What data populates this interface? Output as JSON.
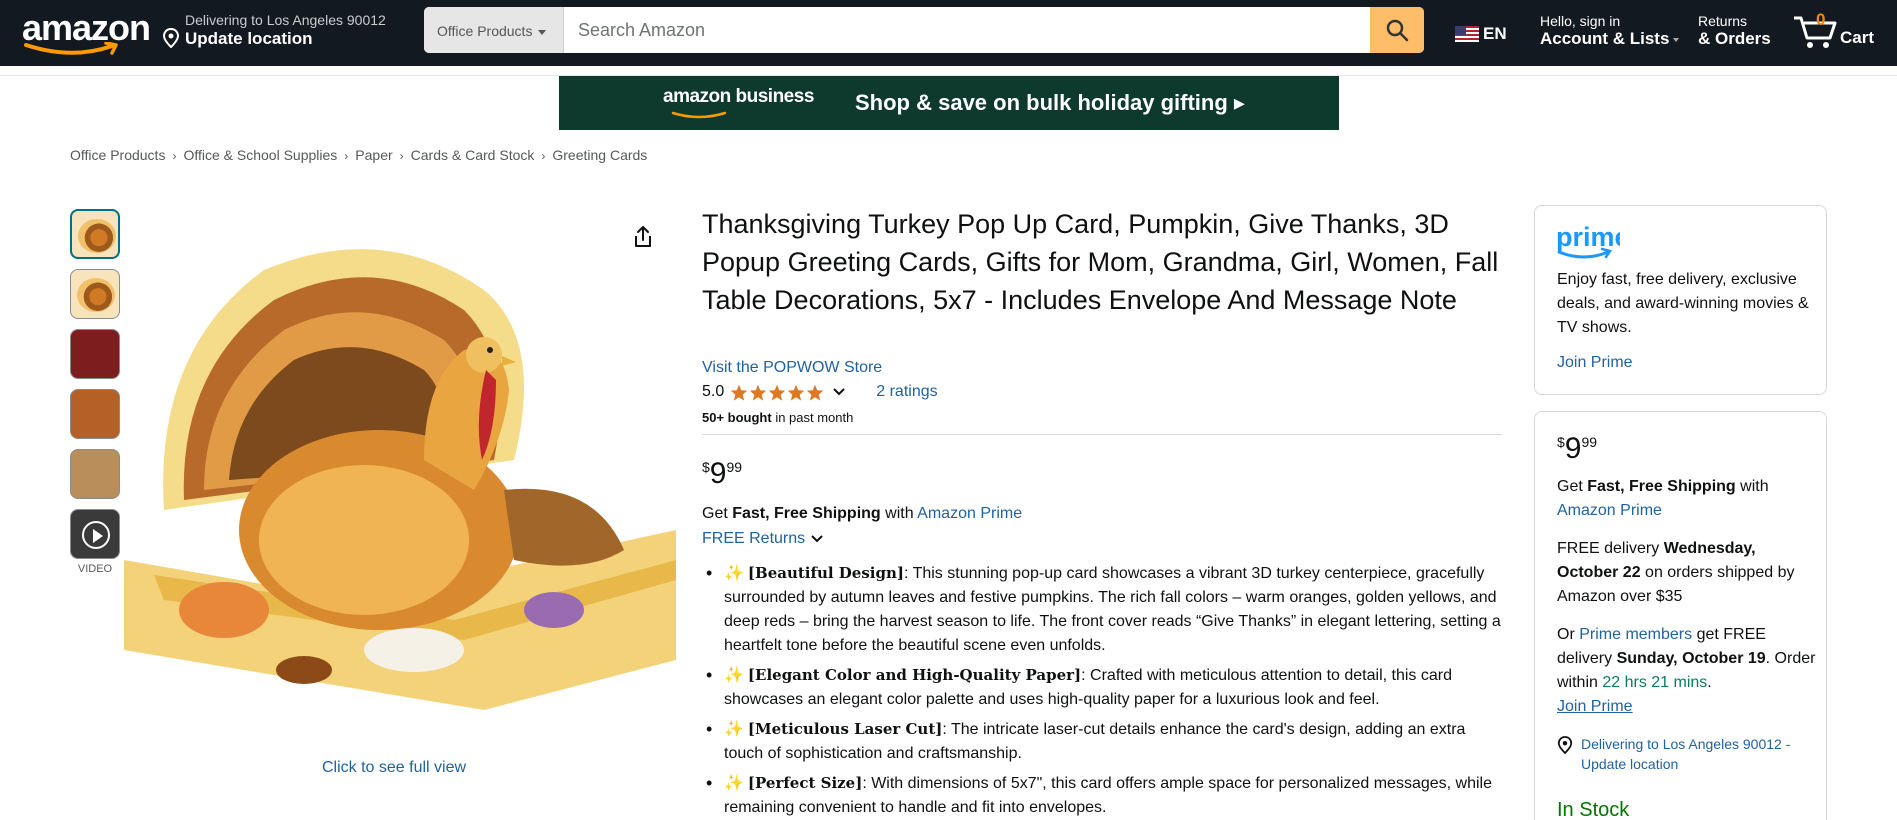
{
  "nav": {
    "logo": "amazon",
    "deliver_line1": "Delivering to Los Angeles 90012",
    "deliver_line2": "Update location",
    "search_category": "Office Products",
    "search_placeholder": "Search Amazon",
    "language": "EN",
    "account_line1": "Hello, sign in",
    "account_line2": "Account & Lists",
    "orders_line1": "Returns",
    "orders_line2": "& Orders",
    "cart_count": "0",
    "cart_label": "Cart"
  },
  "banner": {
    "brand": "amazon business",
    "promo": "Shop & save on bulk holiday gifting ▸"
  },
  "breadcrumb": [
    "Office Products",
    "Office & School Supplies",
    "Paper",
    "Cards & Card Stock",
    "Greeting Cards"
  ],
  "gallery": {
    "video_label": "VIDEO",
    "full_view": "Click to see full view"
  },
  "product": {
    "title": "Thanksgiving Turkey Pop Up Card, Pumpkin, Give Thanks, 3D Popup Greeting Cards, Gifts for Mom, Grandma, Girl, Women, Fall Table Decorations, 5x7 - Includes Envelope And Message Note",
    "store": "Visit the POPWOW Store",
    "rating_value": "5.0",
    "rating_count": "2 ratings",
    "bought_bold": "50+ bought",
    "bought_rest": " in past month",
    "price_symbol": "$",
    "price_whole": "9",
    "price_cents": "99",
    "ship_pre": "Get ",
    "ship_bold": "Fast, Free Shipping",
    "ship_mid": " with ",
    "ship_link": "Amazon Prime",
    "free_returns": "FREE Returns",
    "bullets": [
      {
        "head": "[Beautiful Design]",
        "text": ": This stunning pop-up card showcases a vibrant 3D turkey centerpiece, gracefully surrounded by autumn leaves and festive pumpkins. The rich fall colors – warm oranges, golden yellows, and deep reds – bring the harvest season to life. The front cover reads “Give Thanks” in elegant lettering, setting a heartfelt tone before the beautiful scene even unfolds."
      },
      {
        "head": "[Elegant Color and High-Quality Paper]",
        "text": ": Crafted with meticulous attention to detail, this card showcases an elegant color palette and uses high-quality paper for a luxurious look and feel."
      },
      {
        "head": "[Meticulous Laser Cut]",
        "text": ": The intricate laser-cut details enhance the card's design, adding an extra touch of sophistication and craftsmanship."
      },
      {
        "head": "[Perfect Size]",
        "text": ": With dimensions of 5x7\", this card offers ample space for personalized messages, while remaining convenient to handle and fit into envelopes."
      }
    ]
  },
  "prime_box": {
    "logo": "prime",
    "description": "Enjoy fast, free delivery, exclusive deals, and award-winning movies & TV shows.",
    "join": "Join Prime"
  },
  "buy_box": {
    "price_symbol": "$",
    "price_whole": "9",
    "price_cents": "99",
    "ship_pre": "Get ",
    "ship_bold": "Fast, Free Shipping",
    "ship_mid": " with",
    "ship_link": "Amazon Prime",
    "delivery_pre": "FREE delivery ",
    "delivery_date": "Wednesday, October 22",
    "delivery_post": " on orders shipped by Amazon over $35",
    "or_pre": "Or ",
    "prime_members": "Prime members",
    "or_mid": " get FREE delivery ",
    "fast_date": "Sunday, October 19",
    "order_within": ". Order within ",
    "countdown": "22 hrs 21 mins",
    "period": ".",
    "join_prime": "Join Prime",
    "location": "Delivering to Los Angeles 90012 - Update location",
    "stock": "In Stock"
  },
  "colors": {
    "nav_bg": "#131921",
    "search_button": "#febd69",
    "link": "#2162a1",
    "star": "#de7921",
    "stock_green": "#007600",
    "countdown_green": "#067d62"
  }
}
